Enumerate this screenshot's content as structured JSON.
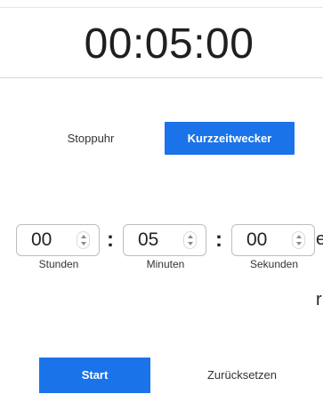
{
  "display": {
    "time": "00:05:00"
  },
  "modes": {
    "stopwatch_label": "Stoppuhr",
    "timer_label": "Kurzzeitwecker",
    "active": "timer"
  },
  "timer": {
    "hours": "00",
    "minutes": "05",
    "seconds": "00",
    "separator": ":",
    "hours_label": "Stunden",
    "minutes_label": "Minuten",
    "seconds_label": "Sekunden"
  },
  "edge_text": {
    "line1": "e",
    "line2": "r"
  },
  "actions": {
    "start_label": "Start",
    "reset_label": "Zurücksetzen"
  },
  "colors": {
    "accent": "#1a73e8",
    "text": "#222222",
    "divider": "#d9d9d9"
  },
  "icons": {
    "spinner": "up-down-chevron-icon"
  }
}
